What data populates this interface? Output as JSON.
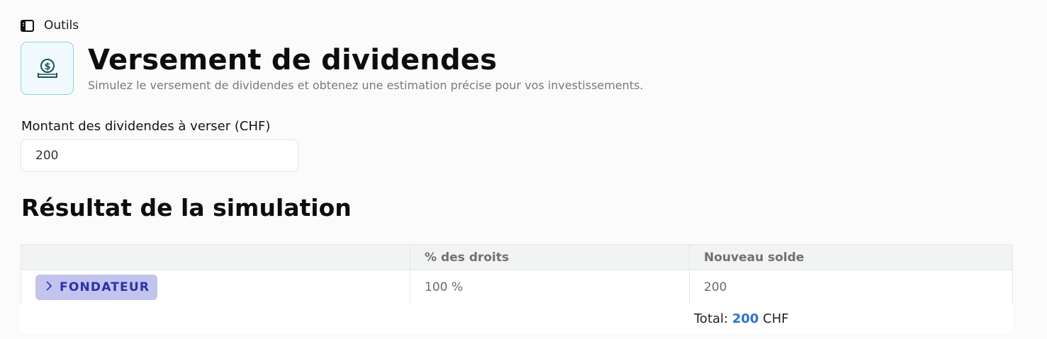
{
  "topbar": {
    "breadcrumb": "Outils"
  },
  "header": {
    "title": "Versement de dividendes",
    "subtitle": "Simulez le versement de dividendes et obtenez une estimation précise pour vos investissements."
  },
  "form": {
    "amount_label": "Montant des dividendes à verser (CHF)",
    "amount_value": "200"
  },
  "results": {
    "title": "Résultat de la simulation",
    "columns": [
      "",
      "% des droits",
      "Nouveau solde"
    ],
    "rows": [
      {
        "group": "FONDATEUR",
        "rights_pct": "100 %",
        "new_balance": "200"
      }
    ],
    "total_label": "Total:",
    "total_value": "200",
    "currency": "CHF"
  },
  "icons": {
    "sidebar": "sidebar-toggle-icon",
    "tool": "dollar-coin-hand-icon",
    "expand": "chevron-right-icon"
  },
  "colors": {
    "accent_blue": "#2a72d4",
    "badge_bg": "#c2c3ef",
    "badge_text": "#2a32a8",
    "tool_icon_border": "#8fd3e0"
  }
}
